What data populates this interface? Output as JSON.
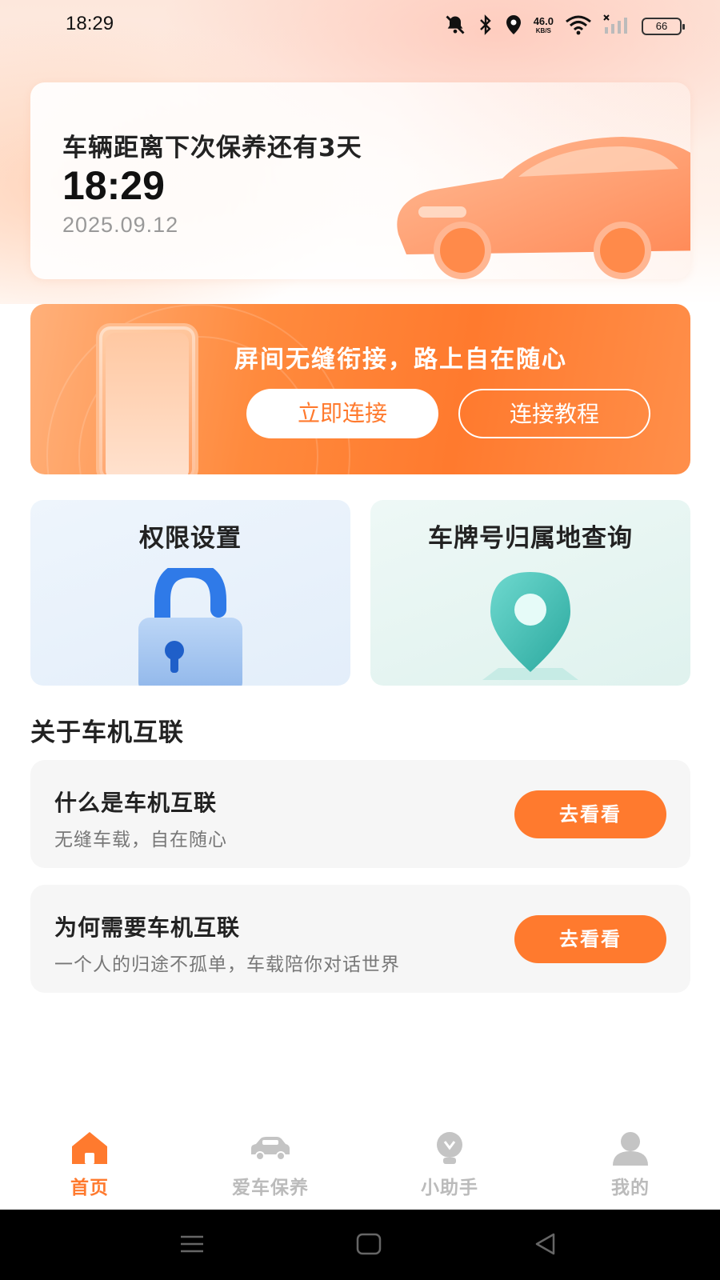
{
  "status_bar": {
    "time": "18:29",
    "net_speed_value": "46.0",
    "net_speed_unit": "KB/S",
    "battery": "66",
    "icons": [
      "mute-icon",
      "bluetooth-icon",
      "location-icon",
      "wifi-icon",
      "signal-icon",
      "battery-icon"
    ]
  },
  "maintenance": {
    "title": "车辆距离下次保养还有3天",
    "time": "18:29",
    "date": "2025.09.12"
  },
  "connect_banner": {
    "title": "屏间无缝衔接，路上自在随心",
    "connect_label": "立即连接",
    "tutorial_label": "连接教程"
  },
  "features": [
    {
      "title": "权限设置",
      "icon": "lock-icon"
    },
    {
      "title": "车牌号归属地查询",
      "icon": "location-pin-icon"
    }
  ],
  "about": {
    "section_title": "关于车机互联",
    "cards": [
      {
        "title": "什么是车机互联",
        "subtitle": "无缝车载，自在随心",
        "button": "去看看"
      },
      {
        "title": "为何需要车机互联",
        "subtitle": "一个人的归途不孤单，车载陪你对话世界",
        "button": "去看看"
      }
    ]
  },
  "bottom_nav": {
    "items": [
      {
        "label": "首页",
        "icon": "home-icon",
        "active": true
      },
      {
        "label": "爱车保养",
        "icon": "car-icon",
        "active": false
      },
      {
        "label": "小助手",
        "icon": "assistant-icon",
        "active": false
      },
      {
        "label": "我的",
        "icon": "profile-icon",
        "active": false
      }
    ]
  },
  "colors": {
    "accent": "#ff7a2e",
    "inactive": "#bbbbbb"
  }
}
